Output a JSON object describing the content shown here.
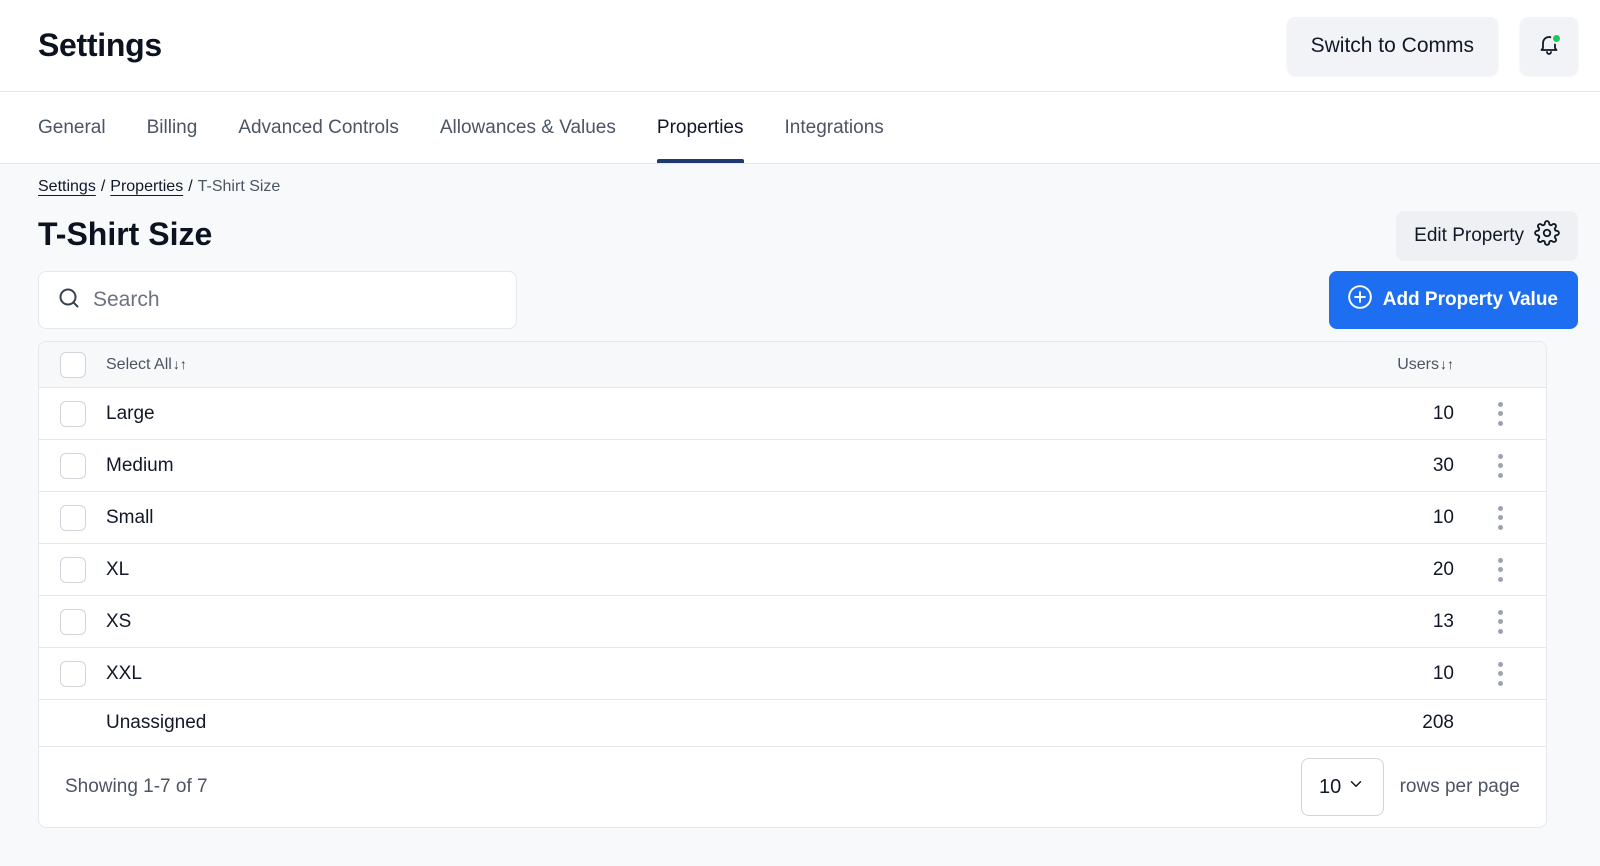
{
  "header": {
    "title": "Settings",
    "switch_label": "Switch to Comms",
    "notification_dot_color": "#22c55e"
  },
  "tabs": [
    {
      "label": "General",
      "active": false
    },
    {
      "label": "Billing",
      "active": false
    },
    {
      "label": "Advanced Controls",
      "active": false
    },
    {
      "label": "Allowances & Values",
      "active": false
    },
    {
      "label": "Properties",
      "active": true
    },
    {
      "label": "Integrations",
      "active": false
    }
  ],
  "breadcrumb": {
    "items": [
      "Settings",
      "Properties"
    ],
    "current": "T-Shirt Size",
    "separator": "/"
  },
  "page": {
    "title": "T-Shirt Size",
    "edit_label": "Edit Property",
    "add_label": "Add Property Value",
    "accent_color": "#1d6ef0"
  },
  "search": {
    "placeholder": "Search",
    "value": ""
  },
  "table": {
    "select_all_label": "Select All",
    "users_label": "Users",
    "sort_glyph": "↓↑",
    "rows": [
      {
        "name": "Large",
        "users": "10"
      },
      {
        "name": "Medium",
        "users": "30"
      },
      {
        "name": "Small",
        "users": "10"
      },
      {
        "name": "XL",
        "users": "20"
      },
      {
        "name": "XS",
        "users": "13"
      },
      {
        "name": "XXL",
        "users": "10"
      }
    ],
    "unassigned": {
      "name": "Unassigned",
      "users": "208"
    }
  },
  "footer": {
    "showing": "Showing 1-7 of 7",
    "rows_value": "10",
    "rows_per_page_label": "rows per page"
  }
}
